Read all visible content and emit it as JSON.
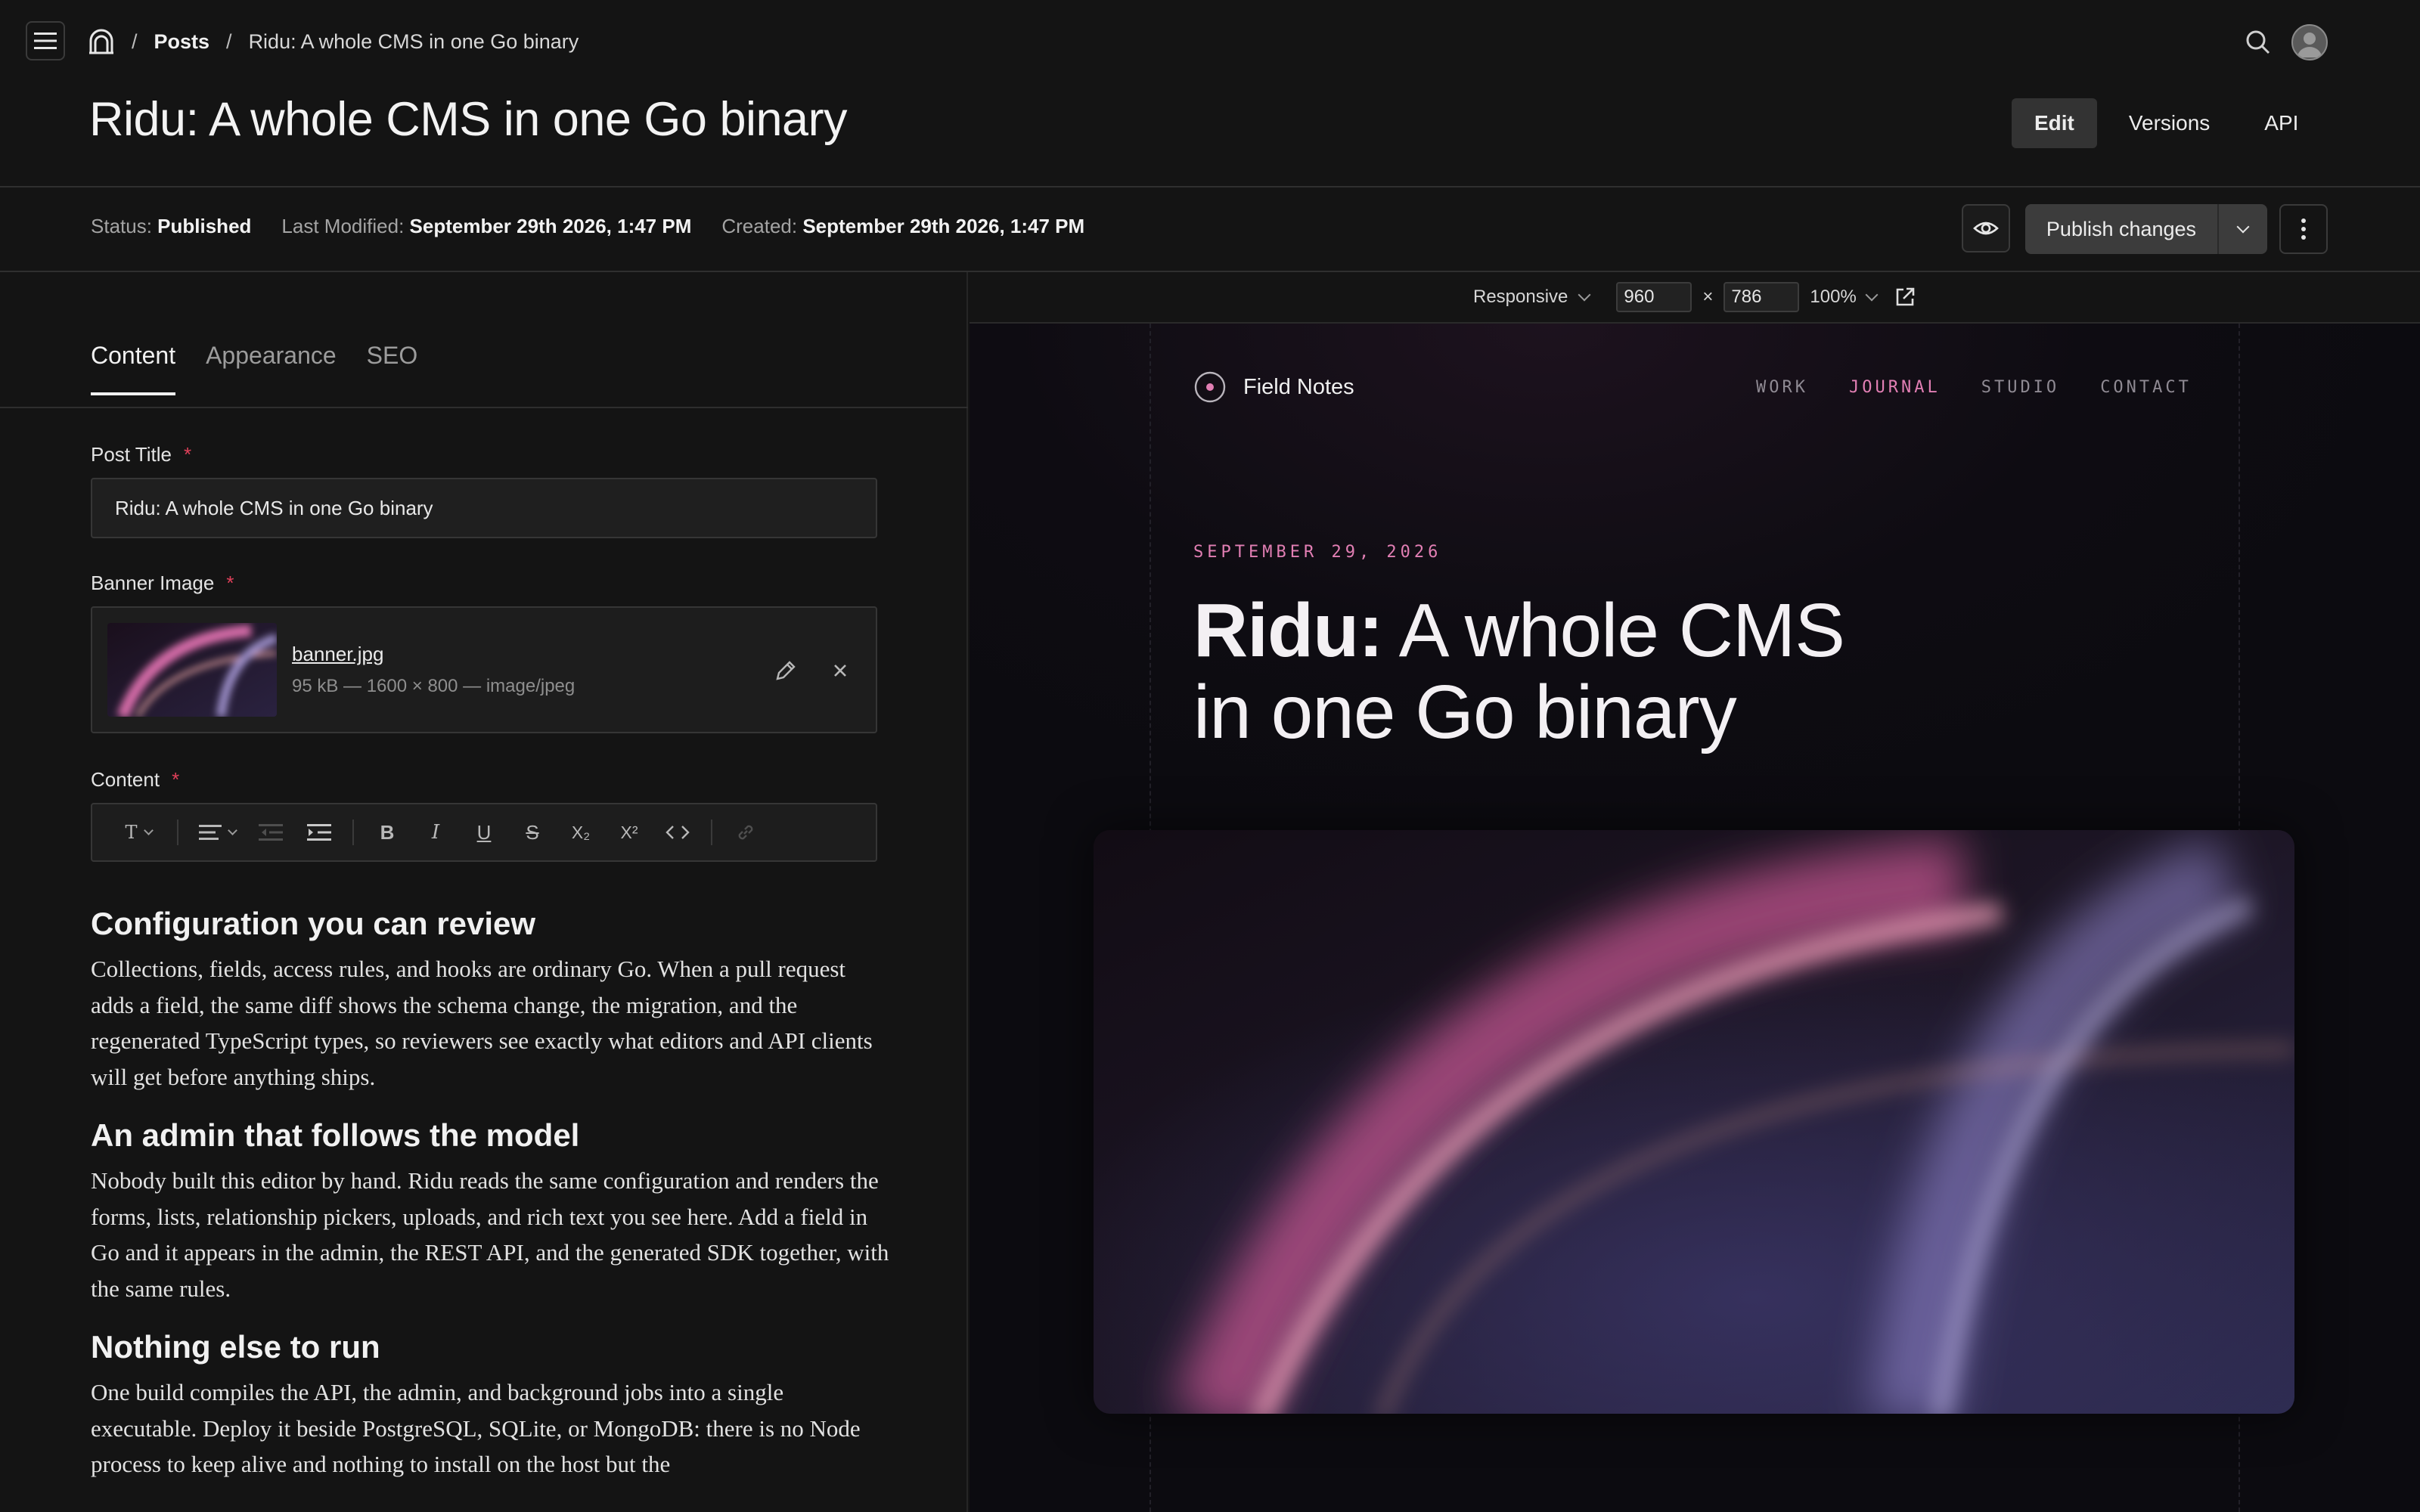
{
  "breadcrumb": {
    "section": "Posts",
    "current": "Ridu: A whole CMS in one Go binary"
  },
  "header": {
    "title": "Ridu: A whole CMS in one Go binary",
    "tabs": [
      {
        "label": "Edit",
        "active": true
      },
      {
        "label": "Versions",
        "active": false
      },
      {
        "label": "API",
        "active": false
      }
    ]
  },
  "meta": {
    "status_label": "Status:",
    "status_value": "Published",
    "modified_label": "Last Modified:",
    "modified_value": "September 29th 2026, 1:47 PM",
    "created_label": "Created:",
    "created_value": "September 29th 2026, 1:47 PM"
  },
  "actions": {
    "publish_label": "Publish changes"
  },
  "responsive": {
    "mode": "Responsive",
    "width": "960",
    "times": "×",
    "height": "786",
    "zoom": "100%"
  },
  "form": {
    "tabs": [
      {
        "label": "Content",
        "active": true
      },
      {
        "label": "Appearance",
        "active": false
      },
      {
        "label": "SEO",
        "active": false
      }
    ],
    "post_title_label": "Post Title",
    "post_title_value": "Ridu: A whole CMS in one Go binary",
    "banner_label": "Banner Image",
    "banner_filename": "banner.jpg",
    "banner_meta": "95 kB — 1600 × 800 — image/jpeg",
    "content_label": "Content",
    "required_mark": "*",
    "toolbar": {
      "text_style": "T",
      "bold": "B",
      "italic": "I",
      "underline": "U",
      "strike": "S",
      "subscript": "X₂",
      "superscript": "X²"
    }
  },
  "content": {
    "sections": [
      {
        "heading": "Configuration you can review",
        "body": "Collections, fields, access rules, and hooks are ordinary Go. When a pull request adds a field, the same diff shows the schema change, the migration, and the regenerated TypeScript types, so reviewers see exactly what editors and API clients will get before anything ships."
      },
      {
        "heading": "An admin that follows the model",
        "body": "Nobody built this editor by hand. Ridu reads the same configuration and renders the forms, lists, relationship pickers, uploads, and rich text you see here. Add a field in Go and it appears in the admin, the REST API, and the generated SDK together, with the same rules."
      },
      {
        "heading": "Nothing else to run",
        "body": "One build compiles the API, the admin, and background jobs into a single executable. Deploy it beside PostgreSQL, SQLite, or MongoDB: there is no Node process to keep alive and nothing to install on the host but the"
      }
    ]
  },
  "preview": {
    "site_name": "Field Notes",
    "nav": [
      {
        "label": "WORK",
        "active": false
      },
      {
        "label": "JOURNAL",
        "active": true
      },
      {
        "label": "STUDIO",
        "active": false
      },
      {
        "label": "CONTACT",
        "active": false
      }
    ],
    "date": "SEPTEMBER 29, 2026",
    "title_bold": "Ridu:",
    "title_rest": " A whole CMS in one Go binary"
  },
  "colors": {
    "accent_pink": "#e27fb4",
    "required_red": "#e0405a"
  }
}
